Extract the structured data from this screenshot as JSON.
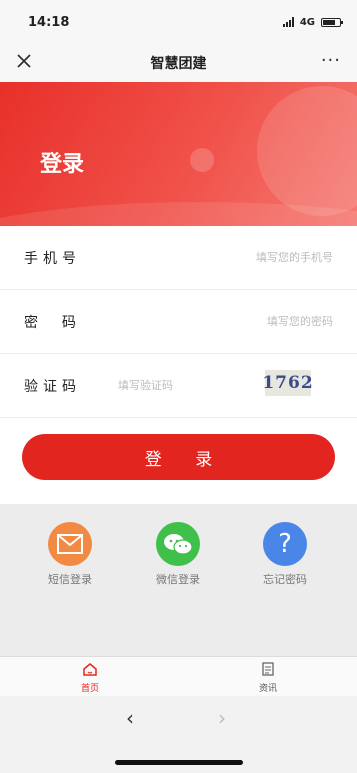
{
  "status_bar": {
    "time": "14:18",
    "network": "4G"
  },
  "nav": {
    "title": "智慧团建",
    "close_icon": "close-icon",
    "more_icon": "more-icon",
    "more_glyph": "···"
  },
  "banner": {
    "title": "登录",
    "color": "#e8302a"
  },
  "form": {
    "phone": {
      "label": "手机号",
      "placeholder": "填写您的手机号"
    },
    "password": {
      "label": "密  码",
      "placeholder": "填写您的密码"
    },
    "code": {
      "label": "验证码",
      "placeholder": "填写验证码",
      "captcha": "1762"
    },
    "login_button": "登 录"
  },
  "alt_login": [
    {
      "label": "短信登录",
      "icon": "envelope-icon",
      "color": "#f28a44"
    },
    {
      "label": "微信登录",
      "icon": "wechat-icon",
      "color": "#3fc04a"
    },
    {
      "label": "忘记密码",
      "icon": "question-icon",
      "color": "#4a86e8"
    }
  ],
  "tabbar": {
    "home": {
      "label": "首页",
      "icon": "home-icon",
      "active": true
    },
    "news": {
      "label": "资讯",
      "icon": "news-icon",
      "active": false
    },
    "active_color": "#e2261f"
  },
  "browser": {
    "back_glyph": "‹",
    "forward_glyph": "›"
  }
}
